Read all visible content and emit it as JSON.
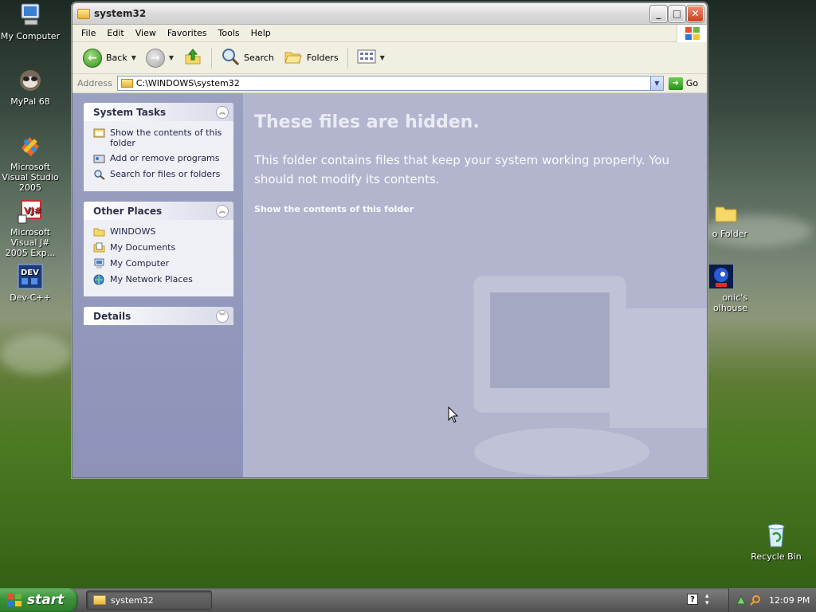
{
  "desktop": {
    "icons": [
      {
        "label": "My Computer"
      },
      {
        "label": "MyPal 68"
      },
      {
        "label": "Microsoft Visual Studio 2005"
      },
      {
        "label": "Microsoft Visual J# 2005 Exp..."
      },
      {
        "label": "Dev-C++"
      },
      {
        "label": "o Folder"
      },
      {
        "label": "onic's olhouse"
      },
      {
        "label": "Recycle Bin"
      }
    ]
  },
  "window": {
    "title": "system32",
    "menu": [
      "File",
      "Edit",
      "View",
      "Favorites",
      "Tools",
      "Help"
    ],
    "toolbar": {
      "back": "Back",
      "search": "Search",
      "folders": "Folders"
    },
    "address": {
      "label": "Address",
      "value": "C:\\WINDOWS\\system32",
      "go": "Go"
    },
    "system_tasks": {
      "title": "System Tasks",
      "items": [
        {
          "label": "Show the contents of this folder",
          "icon": "folder-contents-icon"
        },
        {
          "label": "Add or remove programs",
          "icon": "add-remove-icon"
        },
        {
          "label": "Search for files or folders",
          "icon": "search-icon"
        }
      ]
    },
    "other_places": {
      "title": "Other Places",
      "items": [
        {
          "label": "WINDOWS",
          "icon": "folder-icon"
        },
        {
          "label": "My Documents",
          "icon": "documents-icon"
        },
        {
          "label": "My Computer",
          "icon": "computer-icon"
        },
        {
          "label": "My Network Places",
          "icon": "network-icon"
        }
      ]
    },
    "details": {
      "title": "Details"
    },
    "main": {
      "heading": "These files are hidden.",
      "message": "This folder contains files that keep your system working properly. You should not modify its contents.",
      "link": "Show the contents of this folder"
    }
  },
  "taskbar": {
    "start": "start",
    "task": "system32",
    "clock": "12:09 PM"
  },
  "colors": {
    "accent_green": "#3b923a",
    "panel_blue": "#8d93b8",
    "main_pane": "#b3b5cf"
  }
}
